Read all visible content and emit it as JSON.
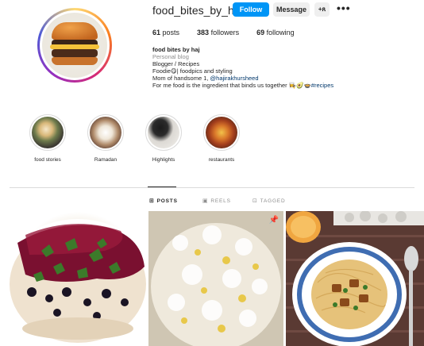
{
  "profile": {
    "username": "food_bites_by_haj",
    "follow_label": "Follow",
    "message_label": "Message",
    "suggest_label": "+ጸ",
    "more_label": "•••",
    "stats": {
      "posts_count": "61",
      "posts_label": "posts",
      "followers_count": "383",
      "followers_label": "followers",
      "following_count": "69",
      "following_label": "following"
    },
    "bio": {
      "name": "food bites by haj",
      "category": "Personal blog",
      "line1": "Blogger / Recipes",
      "line2": "Foodie😋| foodpics and styling",
      "line3_prefix": "Mom of handsome 1, ",
      "line3_link": "@hajirakhursheed",
      "line4_prefix": "For me food is the ingredient that binds us together 👩‍🍳🥑🍲",
      "line4_hashtag": "#recipes"
    }
  },
  "highlights": [
    {
      "label": "food stories"
    },
    {
      "label": "Ramadan"
    },
    {
      "label": "Highlights"
    },
    {
      "label": "restaurants"
    }
  ],
  "tabs": {
    "posts": "POSTS",
    "reels": "REELS",
    "tagged": "TAGGED"
  },
  "colors": {
    "follow_button": "#0095f6",
    "link": "#00376b",
    "secondary_button": "#efefef"
  }
}
